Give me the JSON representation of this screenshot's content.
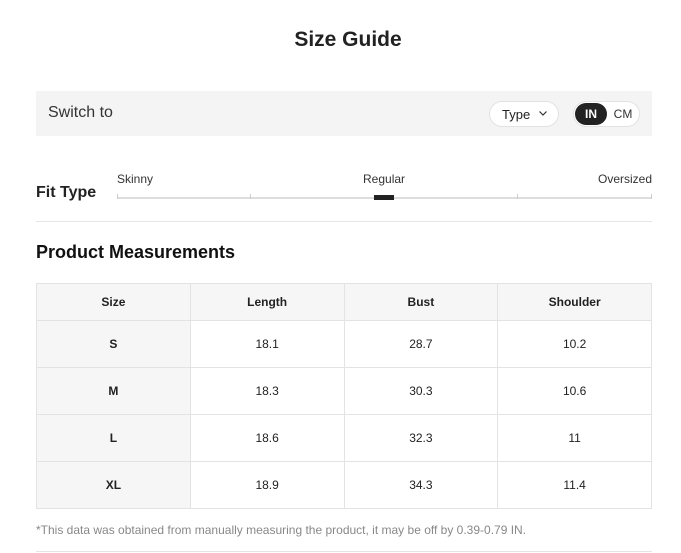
{
  "header": {
    "title": "Size Guide"
  },
  "switch_bar": {
    "label": "Switch to",
    "type_dropdown": {
      "label": "Type",
      "icon": "chevron-down-icon"
    },
    "units": {
      "options": [
        "IN",
        "CM"
      ],
      "selected": "IN"
    }
  },
  "fit_type": {
    "label": "Fit Type",
    "scale": [
      "Skinny",
      "Regular",
      "Oversized"
    ],
    "selected": "Regular"
  },
  "measurements": {
    "title": "Product Measurements",
    "columns": [
      "Size",
      "Length",
      "Bust",
      "Shoulder"
    ],
    "rows": [
      [
        "S",
        "18.1",
        "28.7",
        "10.2"
      ],
      [
        "M",
        "18.3",
        "30.3",
        "10.6"
      ],
      [
        "L",
        "18.6",
        "32.3",
        "11"
      ],
      [
        "XL",
        "18.9",
        "34.3",
        "11.4"
      ]
    ]
  },
  "note": "*This data was obtained from manually measuring the product, it may be off by 0.39-0.79 IN.",
  "colors": {
    "accent": "#222222",
    "bar_background": "#f4f4f4",
    "header_cell_background": "#f6f6f6",
    "note_text": "#888888"
  }
}
